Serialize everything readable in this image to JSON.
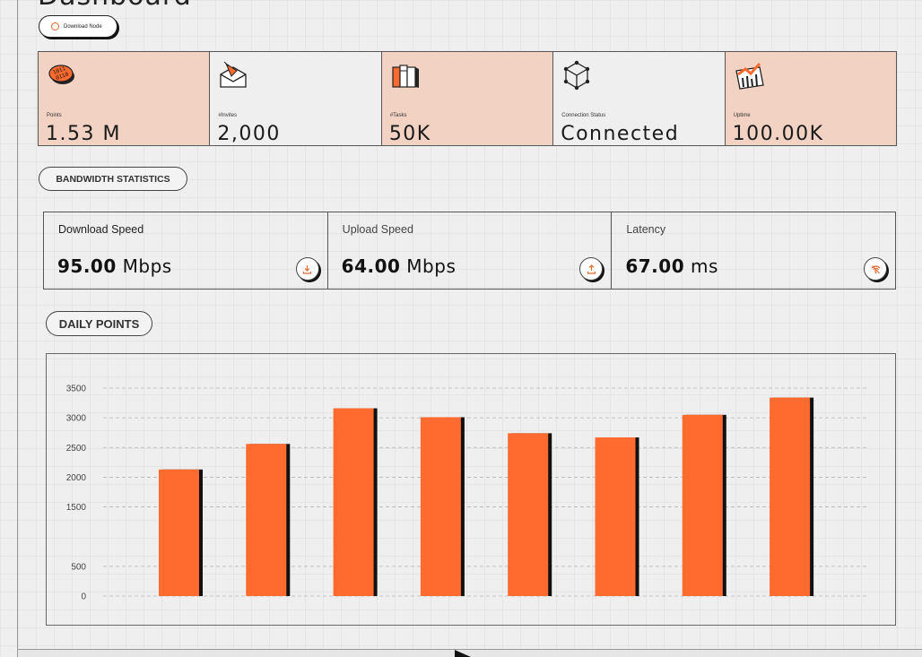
{
  "page": {
    "title": "Dashboard"
  },
  "header": {
    "download_button": "Download Node"
  },
  "stats": [
    {
      "label": "Points",
      "value": "1.53 M",
      "icon": "binary-coin-icon",
      "accent": true
    },
    {
      "label": "#Invites",
      "value": "2,000",
      "icon": "envelope-icon",
      "accent": false
    },
    {
      "label": "#Tasks",
      "value": "50K",
      "icon": "books-icon",
      "accent": true
    },
    {
      "label": "Connection Status",
      "value": "Connected",
      "icon": "cube-network-icon",
      "accent": false
    },
    {
      "label": "Uptime",
      "value": "100.00K",
      "icon": "trend-chart-icon",
      "accent": true
    }
  ],
  "bandwidth": {
    "section_title": "BANDWIDTH STATISTICS",
    "download": {
      "label": "Download Speed",
      "value": "95.00",
      "unit": "Mbps",
      "icon": "download-icon"
    },
    "upload": {
      "label": "Upload Speed",
      "value": "64.00",
      "unit": "Mbps",
      "icon": "upload-icon"
    },
    "latency": {
      "label": "Latency",
      "value": "67.00",
      "unit": "ms",
      "icon": "wifi-icon"
    }
  },
  "daily": {
    "section_title": "DAILY POINTS"
  },
  "colors": {
    "accent": "#ff6a2f",
    "card_accent": "#f2d2c3",
    "bar_shadow": "#111111"
  },
  "chart_data": {
    "type": "bar",
    "categories": [
      "",
      "",
      "",
      "",
      "",
      "",
      "",
      ""
    ],
    "values": [
      2130,
      2560,
      3160,
      3010,
      2740,
      2670,
      3050,
      3340
    ],
    "ylim": [
      0,
      3500
    ],
    "yticks": [
      "0",
      "500",
      "1500",
      "2000",
      "2500",
      "3000",
      "3500"
    ],
    "grid": true,
    "title": "",
    "xlabel": "",
    "ylabel": ""
  }
}
